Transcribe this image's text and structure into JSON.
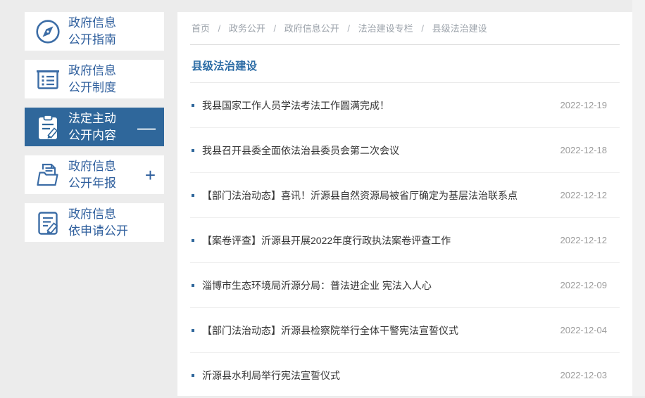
{
  "sidebar": {
    "items": [
      {
        "line1": "政府信息",
        "line2": "公开指南",
        "icon": "compass-icon",
        "toggle": "",
        "active": false
      },
      {
        "line1": "政府信息",
        "line2": "公开制度",
        "icon": "notebook-icon",
        "toggle": "",
        "active": false
      },
      {
        "line1": "法定主动",
        "line2": "公开内容",
        "icon": "clipboard-pencil-icon",
        "toggle": "—",
        "active": true
      },
      {
        "line1": "政府信息",
        "line2": "公开年报",
        "icon": "folder-document-icon",
        "toggle": "+",
        "active": false
      },
      {
        "line1": "政府信息",
        "line2": "依申请公开",
        "icon": "document-pencil-icon",
        "toggle": "",
        "active": false
      }
    ]
  },
  "breadcrumb": {
    "separator": "/",
    "items": [
      "首页",
      "政务公开",
      "政府信息公开",
      "法治建设专栏",
      "县级法治建设"
    ]
  },
  "section": {
    "title": "县级法治建设"
  },
  "news_list": [
    {
      "title": "我县国家工作人员学法考法工作圆满完成！",
      "date": "2022-12-19"
    },
    {
      "title": "我县召开县委全面依法治县委员会第二次会议",
      "date": "2022-12-18"
    },
    {
      "title": "【部门法治动态】喜讯！沂源县自然资源局被省厅确定为基层法治联系点",
      "date": "2022-12-12"
    },
    {
      "title": "【案卷评查】沂源县开展2022年度行政执法案卷评查工作",
      "date": "2022-12-12"
    },
    {
      "title": "淄博市生态环境局沂源分局：普法进企业 宪法入人心",
      "date": "2022-12-09"
    },
    {
      "title": "【部门法治动态】沂源县检察院举行全体干警宪法宣誓仪式",
      "date": "2022-12-04"
    },
    {
      "title": "沂源县水利局举行宪法宣誓仪式",
      "date": "2022-12-03"
    }
  ],
  "colors": {
    "accent_blue": "#2f679b",
    "sidebar_text_blue": "#2f5f9d",
    "title_blue": "#2c6ca5",
    "date_gray": "#9b9b9b",
    "page_background": "#ececec"
  }
}
